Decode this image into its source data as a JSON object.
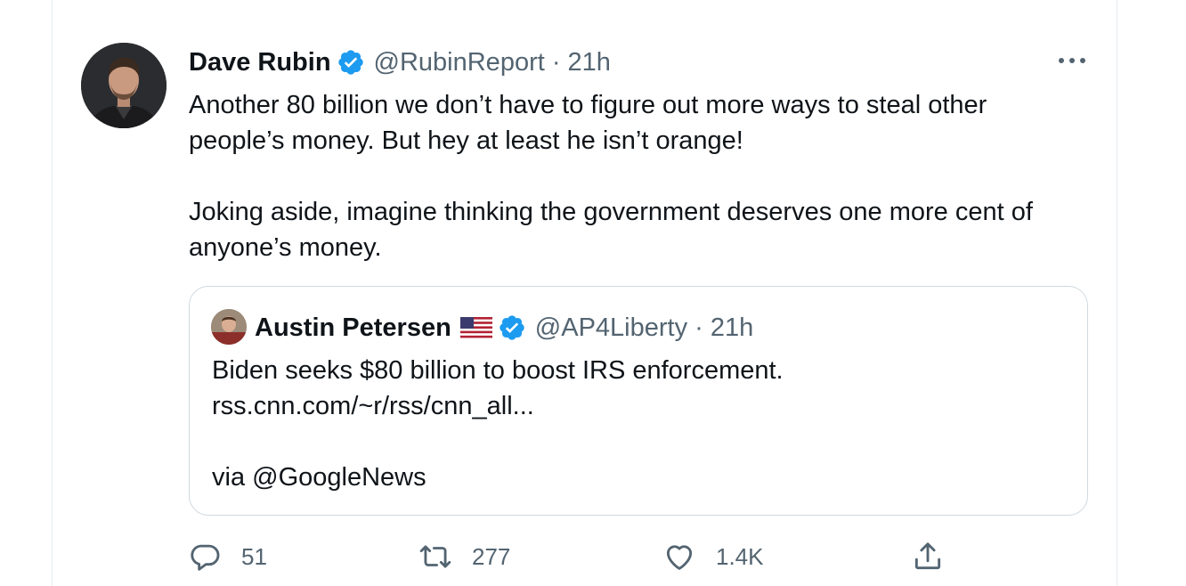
{
  "tweet": {
    "author_name": "Dave Rubin",
    "handle_time": "@RubinReport · 21h",
    "paragraphs": [
      "Another 80 billion we don’t have to figure out more ways to steal other people’s money. But hey at least he isn’t orange!",
      "Joking aside, imagine thinking the government deserves one more cent of anyone’s money."
    ]
  },
  "quoted": {
    "author_name": "Austin Petersen",
    "handle_time": "@AP4Liberty · 21h",
    "lines": [
      "Biden seeks $80 billion to boost IRS enforcement.",
      "rss.cnn.com/~r/rss/cnn_all..."
    ],
    "via": "via @GoogleNews"
  },
  "actions": {
    "reply_count": "51",
    "retweet_count": "277",
    "like_count": "1.4K"
  },
  "icons": {
    "verified": "verified-badge-icon",
    "more": "more-options-icon",
    "flag": "us-flag-icon",
    "reply": "reply-icon",
    "retweet": "retweet-icon",
    "like": "heart-icon",
    "share": "share-icon"
  },
  "colors": {
    "verified_blue": "#1d9bf0",
    "secondary_text": "#536471",
    "border": "#cfd9de"
  }
}
